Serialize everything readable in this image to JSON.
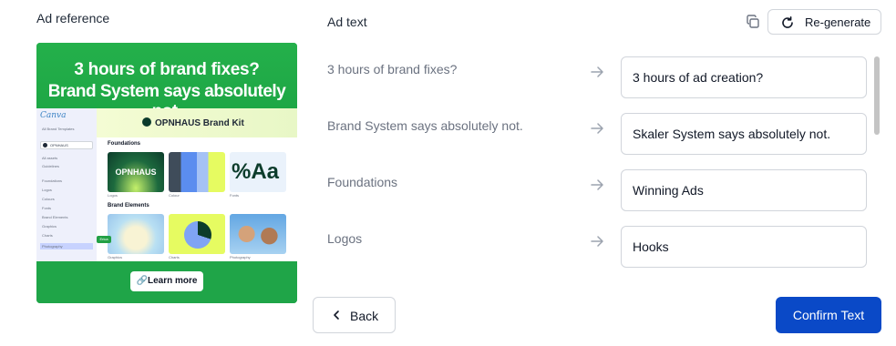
{
  "reference": {
    "label": "Ad reference",
    "ad": {
      "headline_line1": "3 hours of brand fixes?",
      "headline_line2": "Brand System says absolutely not.",
      "app_logo": "Canva",
      "sidebar_items": [
        "All Brand Templates",
        "OPNHAUS",
        "All assets",
        "Guidelines",
        "Foundations",
        "Logos",
        "Colours",
        "Fonts",
        "Brand Elements",
        "Graphics",
        "Charts",
        "Photography"
      ],
      "edit_badge": "Erica",
      "kit_title": "OPNHAUS Brand Kit",
      "section_foundations": "Foundations",
      "tile_logo_text": "OPNHAUS",
      "tile_font_text": "%Aa",
      "caption_logos": "Logos",
      "caption_colour": "Colour",
      "caption_fonts": "Fonts",
      "section_brand_elements": "Brand Elements",
      "caption_graphics": "Graphics",
      "caption_charts": "Charts",
      "caption_photography": "Photography",
      "cta": "🔗Learn more"
    }
  },
  "ad_text": {
    "label": "Ad text",
    "regenerate_label": "Re-generate",
    "rows": [
      {
        "original": "3 hours of brand fixes?",
        "replacement": "3 hours of ad creation?"
      },
      {
        "original": "Brand System says absolutely not.",
        "replacement": "Skaler System says absolutely not."
      },
      {
        "original": "Foundations",
        "replacement": "Winning Ads"
      },
      {
        "original": "Logos",
        "replacement": "Hooks"
      }
    ]
  },
  "footer": {
    "back_label": "Back",
    "confirm_label": "Confirm Text"
  },
  "colors": {
    "accent": "#0a49c7",
    "ad_green": "#1fa548"
  },
  "icons": [
    "copy-icon",
    "refresh-icon",
    "arrow-right-icon",
    "chevron-left-icon"
  ]
}
